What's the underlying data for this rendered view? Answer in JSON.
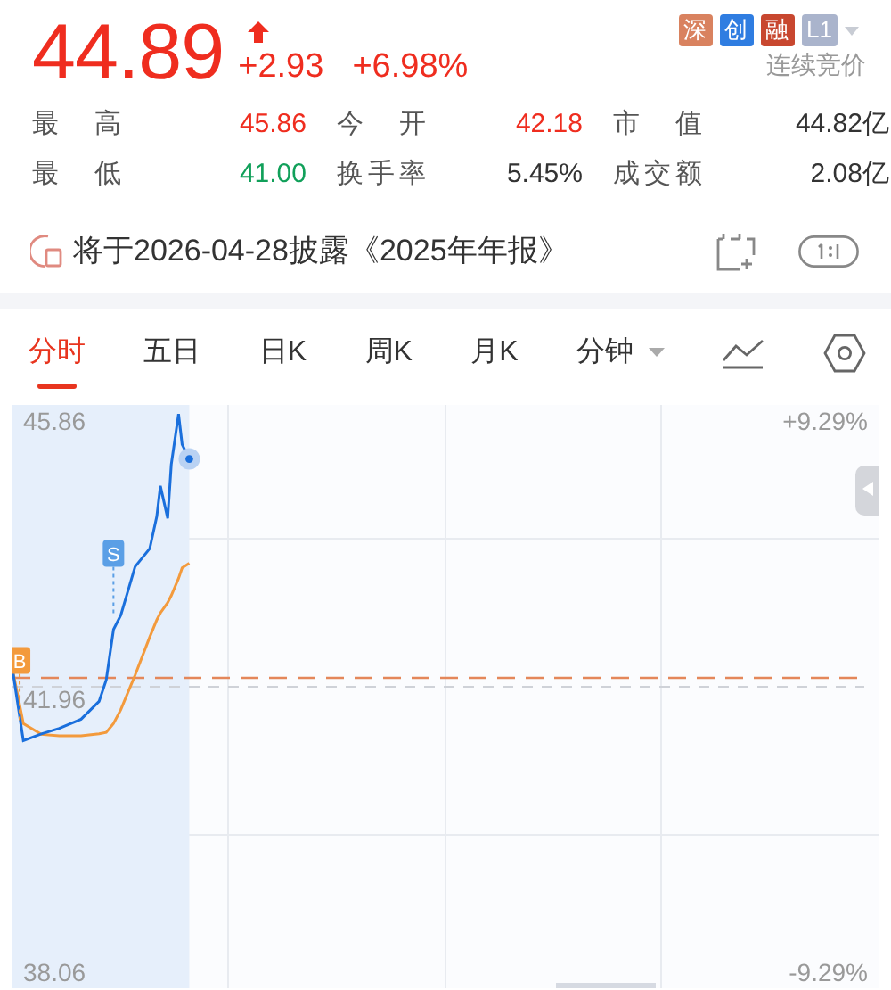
{
  "quote": {
    "price": "44.89",
    "rising": true,
    "change": "+2.93",
    "change_pct": "+6.98%",
    "status": "连续竞价"
  },
  "badges": [
    {
      "label": "深",
      "color": "#d9825f"
    },
    {
      "label": "创",
      "color": "#2f7de1"
    },
    {
      "label": "融",
      "color": "#c8472f"
    },
    {
      "label": "L1",
      "color": "#aab4cc",
      "dropdown": true
    }
  ],
  "stats": [
    {
      "label": "最 高",
      "value": "45.86",
      "color": "#ef2d1f"
    },
    {
      "label": "今 开",
      "value": "42.18",
      "color": "#ef2d1f"
    },
    {
      "label": "市 值",
      "value": "44.82亿",
      "color": "#333333"
    },
    {
      "label": "最 低",
      "value": "41.00",
      "color": "#11a05a"
    },
    {
      "label": "换手率",
      "value": "5.45%",
      "color": "#333333"
    },
    {
      "label": "成交额",
      "value": "2.08亿",
      "color": "#333333"
    }
  ],
  "notice": {
    "text": "将于2026-04-28披露《2025年年报》"
  },
  "tabs": [
    {
      "label": "分时",
      "selected": true,
      "kind": "tab"
    },
    {
      "label": "五日",
      "selected": false,
      "kind": "tab"
    },
    {
      "label": "日K",
      "selected": false,
      "kind": "tab"
    },
    {
      "label": "周K",
      "selected": false,
      "kind": "tab"
    },
    {
      "label": "月K",
      "selected": false,
      "kind": "tab"
    },
    {
      "label": "分钟",
      "selected": false,
      "kind": "dropdown"
    }
  ],
  "chart": {
    "left_labels": [
      "45.86",
      "41.96",
      "38.06"
    ],
    "right_labels": [
      "+9.29%",
      "-9.29%"
    ],
    "markers": [
      {
        "text": "B",
        "kind": "buy"
      },
      {
        "text": "S",
        "kind": "sell"
      }
    ]
  }
}
